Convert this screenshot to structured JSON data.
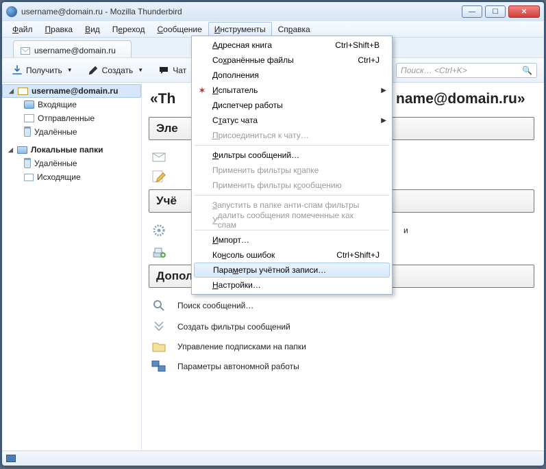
{
  "titlebar": {
    "title": "username@domain.ru - Mozilla Thunderbird"
  },
  "menubar": {
    "file": {
      "text": "Файл",
      "accel": "Ф"
    },
    "edit": {
      "text": "Правка",
      "accel": "П"
    },
    "view": {
      "text": "Вид",
      "accel": "В"
    },
    "go": {
      "text": "Переход",
      "accel": "е"
    },
    "message": {
      "text": "Сообщение",
      "accel": "С"
    },
    "tools": {
      "text": "Инструменты",
      "accel": "И"
    },
    "help": {
      "text": "Справка",
      "accel": "р"
    }
  },
  "tab": {
    "title": "username@domain.ru"
  },
  "toolbar": {
    "get": "Получить",
    "compose": "Создать",
    "chat": "Чат"
  },
  "search": {
    "placeholder": "Поиск… <Ctrl+K>"
  },
  "sidebar": {
    "account": "username@domain.ru",
    "inbox": "Входящие",
    "sent": "Отправленные",
    "trash": "Удалённые",
    "local": "Локальные папки",
    "ltrash": "Удалённые",
    "outbox": "Исходящие"
  },
  "tools_menu": {
    "addressbook": {
      "label": "Адресная книга",
      "shortcut": "Ctrl+Shift+B",
      "accel": "А"
    },
    "saved_files": {
      "label": "Сохранённые файлы",
      "shortcut": "Ctrl+J",
      "accel": "х"
    },
    "addons": {
      "label": "Дополнения",
      "accel": "Д"
    },
    "tester": {
      "label": "Испытатель",
      "accel": "И",
      "submenu": true
    },
    "activity": {
      "label": "Диспетчер работы",
      "accel": "Д"
    },
    "chat_status": {
      "label": "Статус чата",
      "accel": "т",
      "submenu": true
    },
    "join_chat": {
      "label": "Присоединиться к чату…",
      "accel": "П",
      "disabled": true
    },
    "filters": {
      "label": "Фильтры сообщений…",
      "accel": "Ф"
    },
    "apply_folder": {
      "label": "Применить фильтры к папке",
      "accel": "п",
      "disabled": true
    },
    "apply_message": {
      "label": "Применить фильтры к сообщению",
      "accel": "с",
      "disabled": true
    },
    "run_junk": {
      "label": "Запустить в папке анти-спам фильтры",
      "accel": "З",
      "disabled": true
    },
    "delete_junk": {
      "label": "Удалить сообщения помеченные как спам",
      "accel": "У",
      "disabled": true
    },
    "import": {
      "label": "Импорт…",
      "accel": "И"
    },
    "error_console": {
      "label": "Консоль ошибок",
      "shortcut": "Ctrl+Shift+J",
      "accel": "н"
    },
    "account_settings": {
      "label": "Параметры учётной записи…",
      "accel": "м"
    },
    "options": {
      "label": "Настройки…",
      "accel": "Н"
    }
  },
  "content": {
    "title_prefix": "«Th",
    "title_suffix": "name@domain.ru»",
    "section_email_trunc": "Эле",
    "section_accounts_trunc": "Учё",
    "section_extras": "Дополнительные свойства",
    "accounts_trail": "и",
    "links": {
      "search": "Поиск сообщений…",
      "filters": "Создать фильтры сообщений",
      "subs": "Управление подписками на папки",
      "offline": "Параметры автономной работы"
    }
  }
}
